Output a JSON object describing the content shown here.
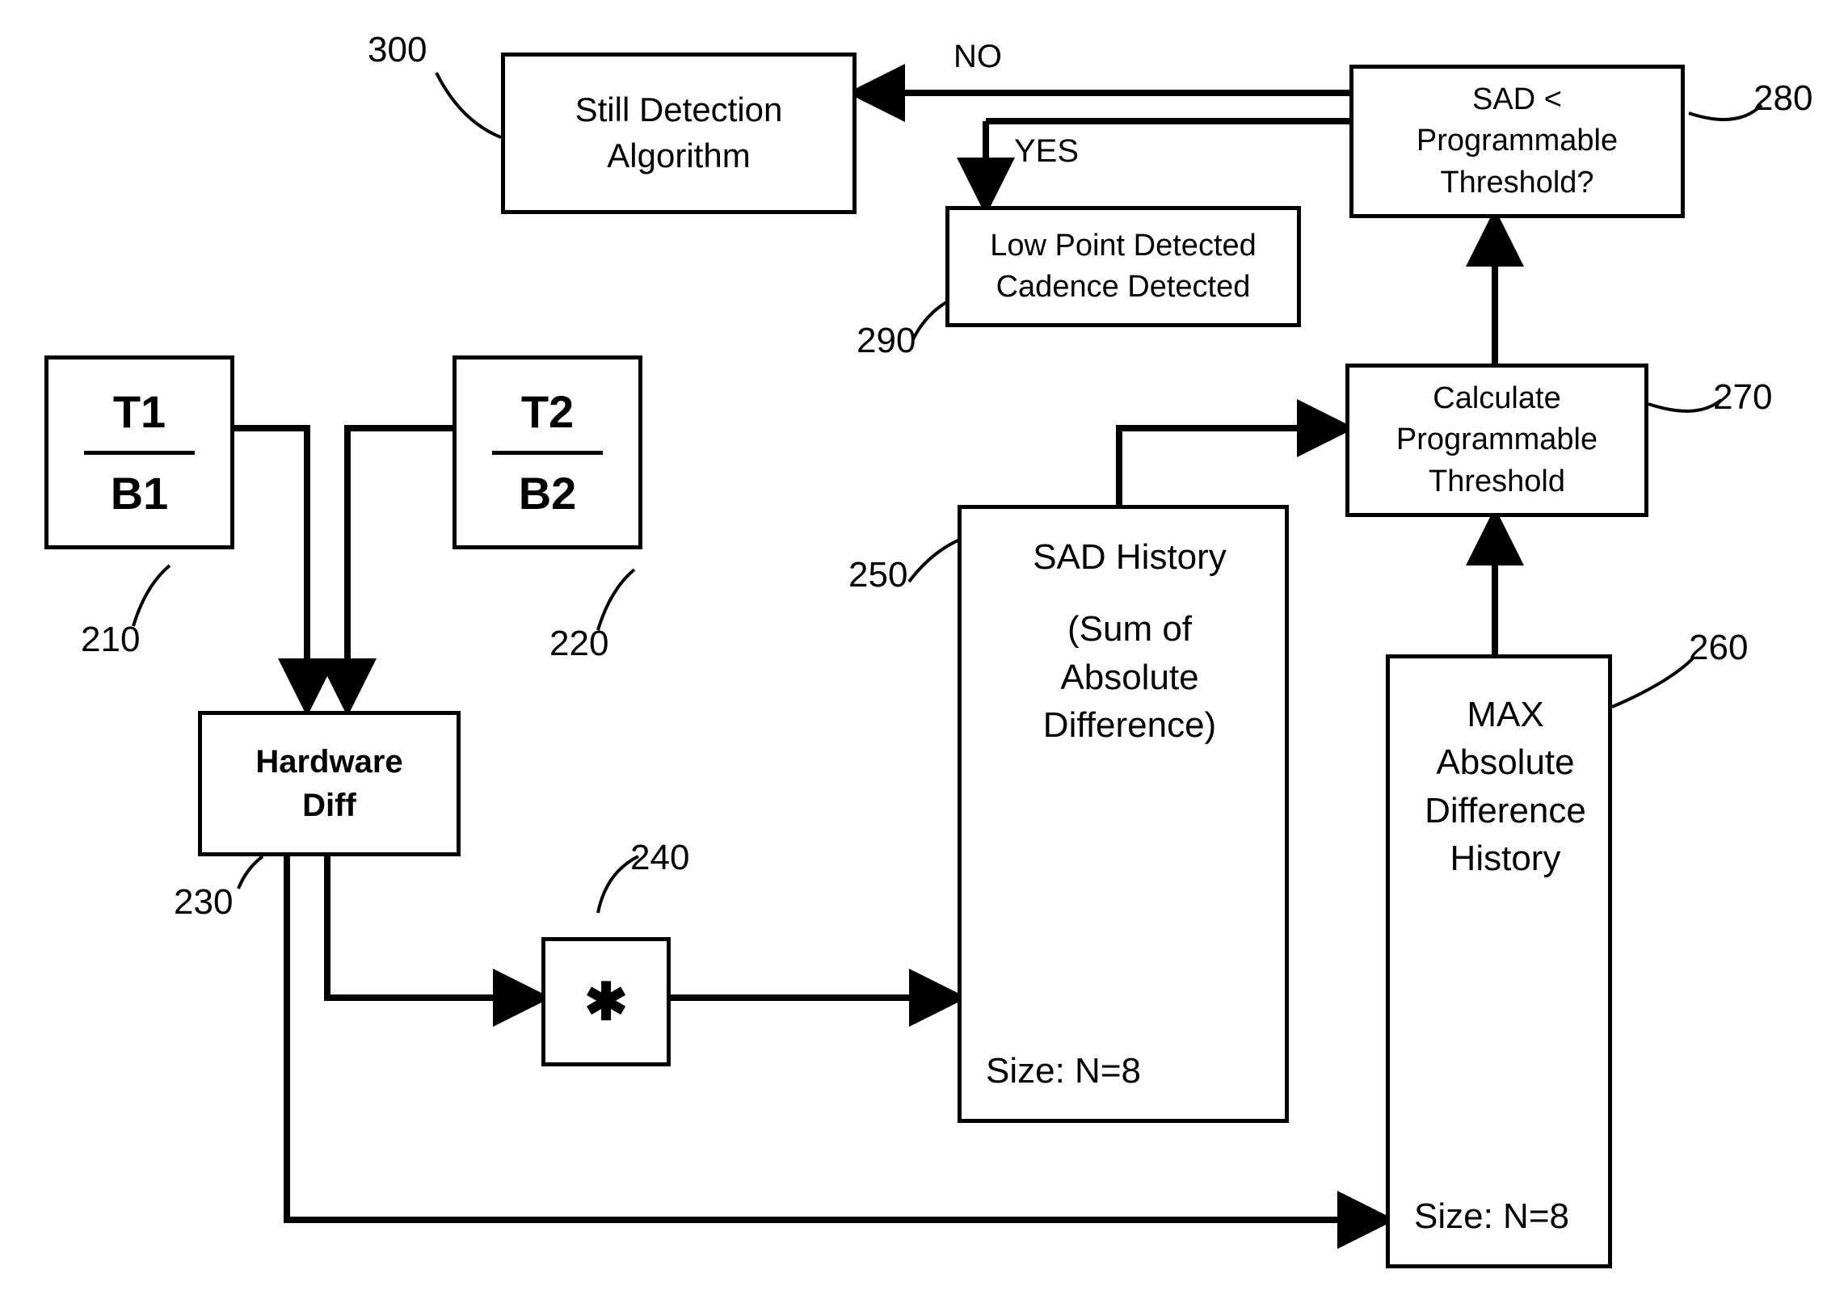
{
  "refs": {
    "r210": "210",
    "r220": "220",
    "r230": "230",
    "r240": "240",
    "r250": "250",
    "r260": "260",
    "r270": "270",
    "r280": "280",
    "r290": "290",
    "r300": "300"
  },
  "boxes": {
    "b210": {
      "t": "T1",
      "b": "B1"
    },
    "b220": {
      "t": "T2",
      "b": "B2"
    },
    "b230": "Hardware\nDiff",
    "b240": "✱",
    "b250": {
      "title": "SAD History",
      "sub": "(Sum of\nAbsolute\nDifference)",
      "size": "Size: N=8"
    },
    "b260": {
      "title": "MAX\nAbsolute\nDifference\nHistory",
      "size": "Size: N=8"
    },
    "b270": "Calculate\nProgrammable\nThreshold",
    "b280": "SAD <\nProgrammable\nThreshold?",
    "b290": "Low Point Detected\nCadence Detected",
    "b300": "Still Detection\nAlgorithm"
  },
  "edges": {
    "no": "NO",
    "yes": "YES"
  }
}
